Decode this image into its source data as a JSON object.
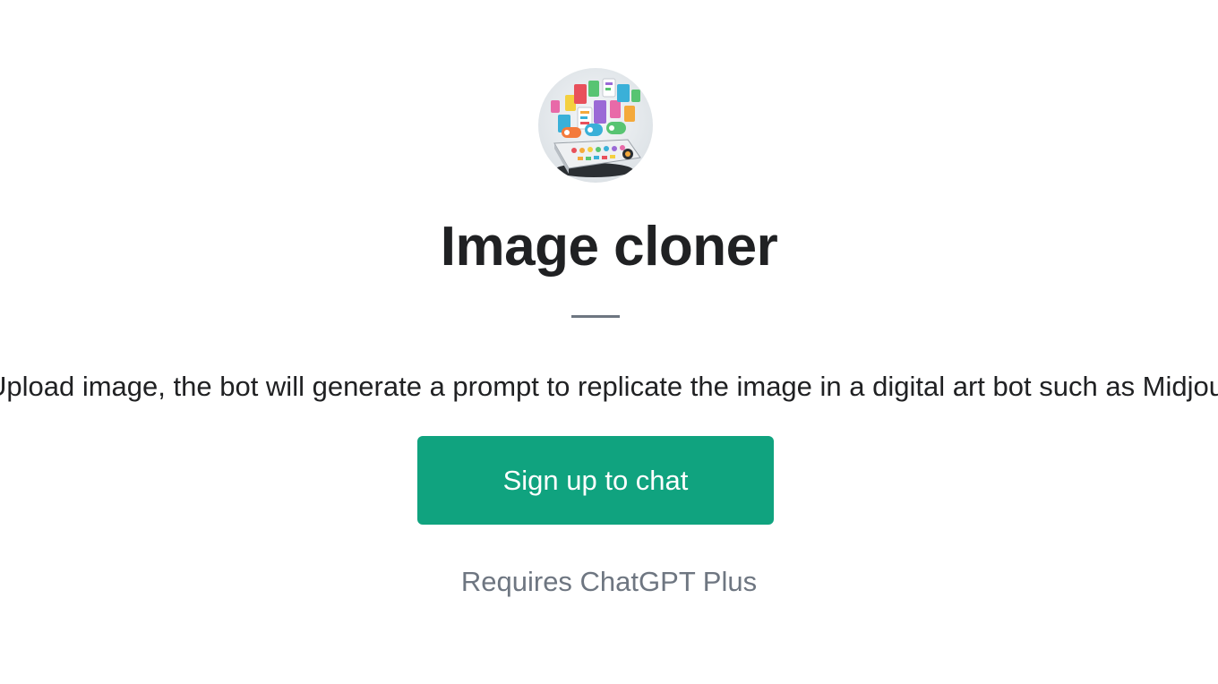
{
  "gpt": {
    "title": "Image cloner",
    "description": "Upload image, the bot will generate a prompt to replicate the image in a digital art bot such as Midjourney",
    "avatar_icon": "gpt-avatar-image",
    "signup_label": "Sign up to chat",
    "requirement": "Requires ChatGPT Plus"
  },
  "colors": {
    "accent": "#10a37f",
    "title_text": "#202123",
    "muted_text": "#6e7681",
    "divider": "#6e7681"
  }
}
